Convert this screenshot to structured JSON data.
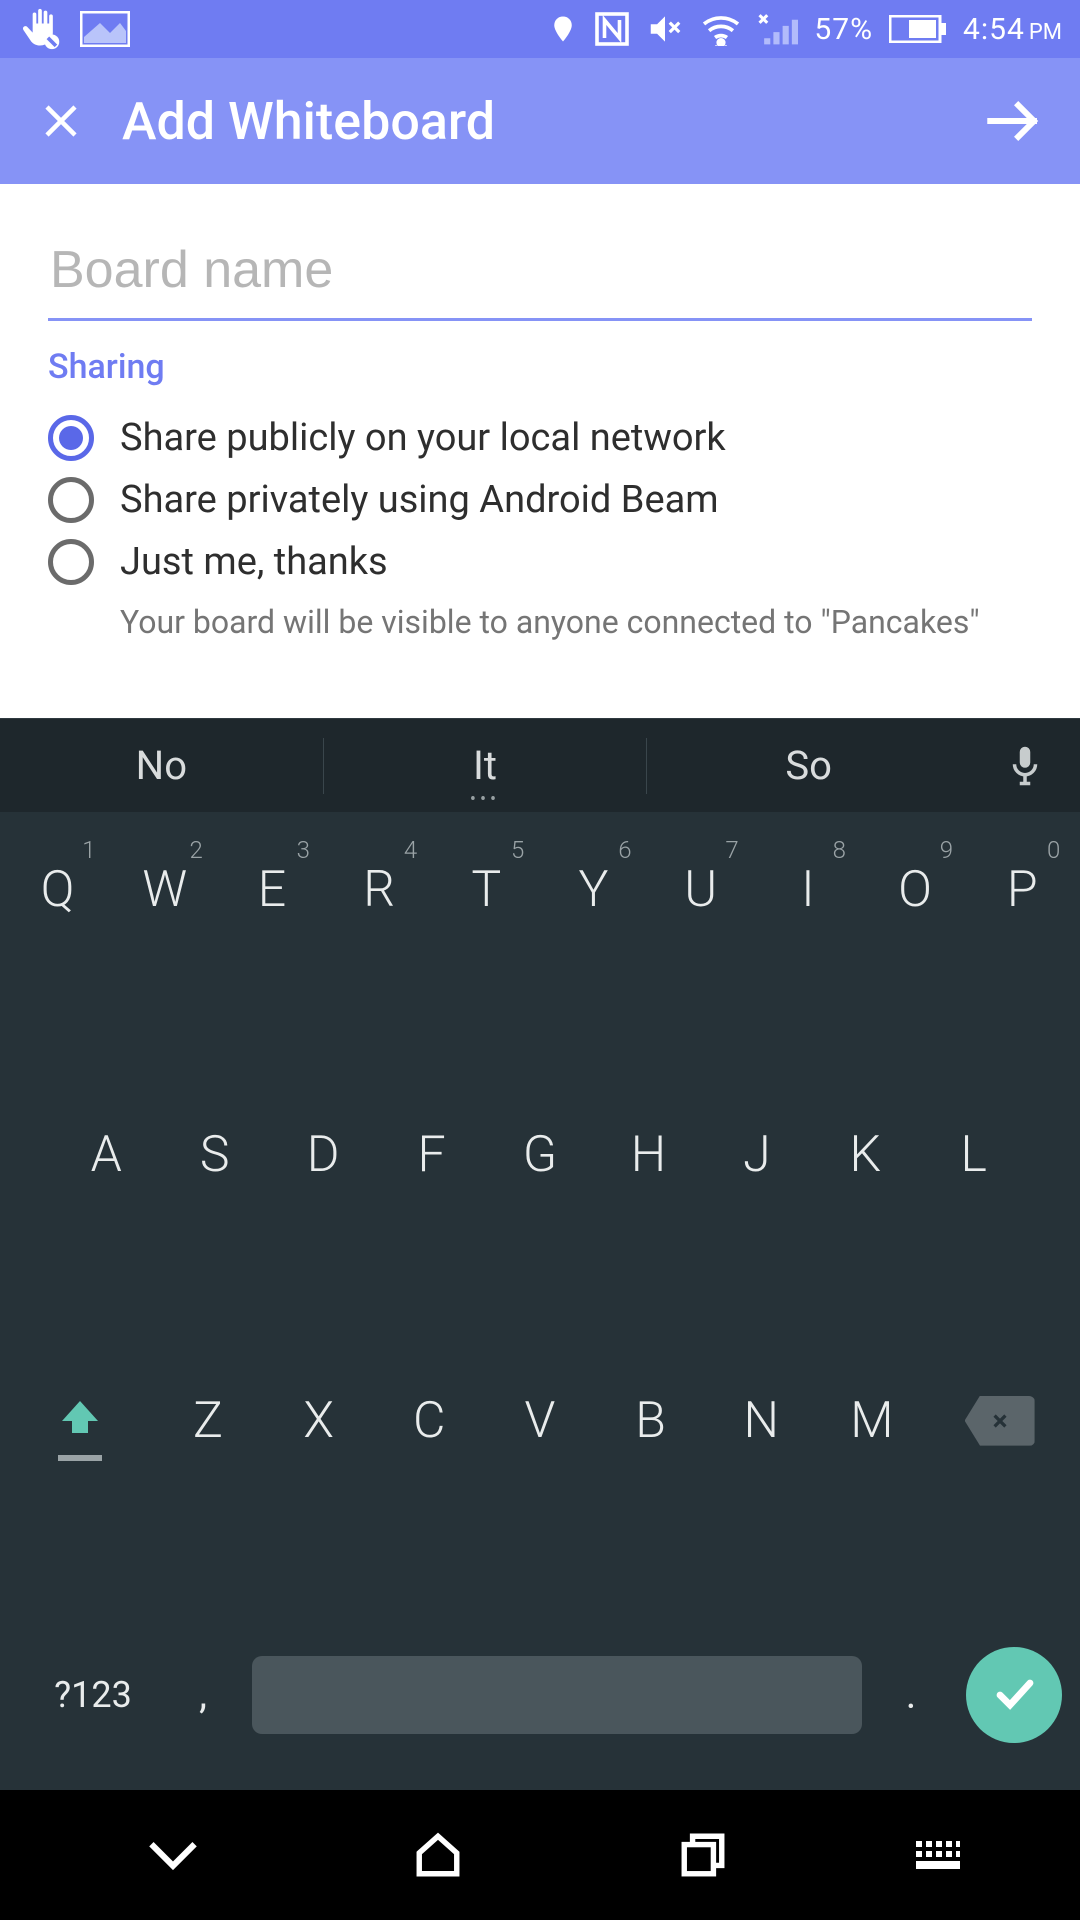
{
  "status": {
    "battery_pct": "57%",
    "time": "4:54",
    "ampm": "PM"
  },
  "appbar": {
    "title": "Add Whiteboard"
  },
  "form": {
    "board_name_placeholder": "Board name",
    "board_name_value": "",
    "section_label": "Sharing",
    "options": [
      {
        "label": "Share publicly on your local network",
        "selected": true
      },
      {
        "label": "Share privately using Android Beam",
        "selected": false
      },
      {
        "label": "Just me, thanks",
        "selected": false
      }
    ],
    "helper": "Your board will be visible to anyone connected to \"Pancakes\""
  },
  "keyboard": {
    "suggestions": [
      "No",
      "It",
      "So"
    ],
    "row1": [
      {
        "k": "Q",
        "n": "1"
      },
      {
        "k": "W",
        "n": "2"
      },
      {
        "k": "E",
        "n": "3"
      },
      {
        "k": "R",
        "n": "4"
      },
      {
        "k": "T",
        "n": "5"
      },
      {
        "k": "Y",
        "n": "6"
      },
      {
        "k": "U",
        "n": "7"
      },
      {
        "k": "I",
        "n": "8"
      },
      {
        "k": "O",
        "n": "9"
      },
      {
        "k": "P",
        "n": "0"
      }
    ],
    "row2": [
      "A",
      "S",
      "D",
      "F",
      "G",
      "H",
      "J",
      "K",
      "L"
    ],
    "row3": [
      "Z",
      "X",
      "C",
      "V",
      "B",
      "N",
      "M"
    ],
    "sym": "?123",
    "comma": ",",
    "dot": "."
  }
}
